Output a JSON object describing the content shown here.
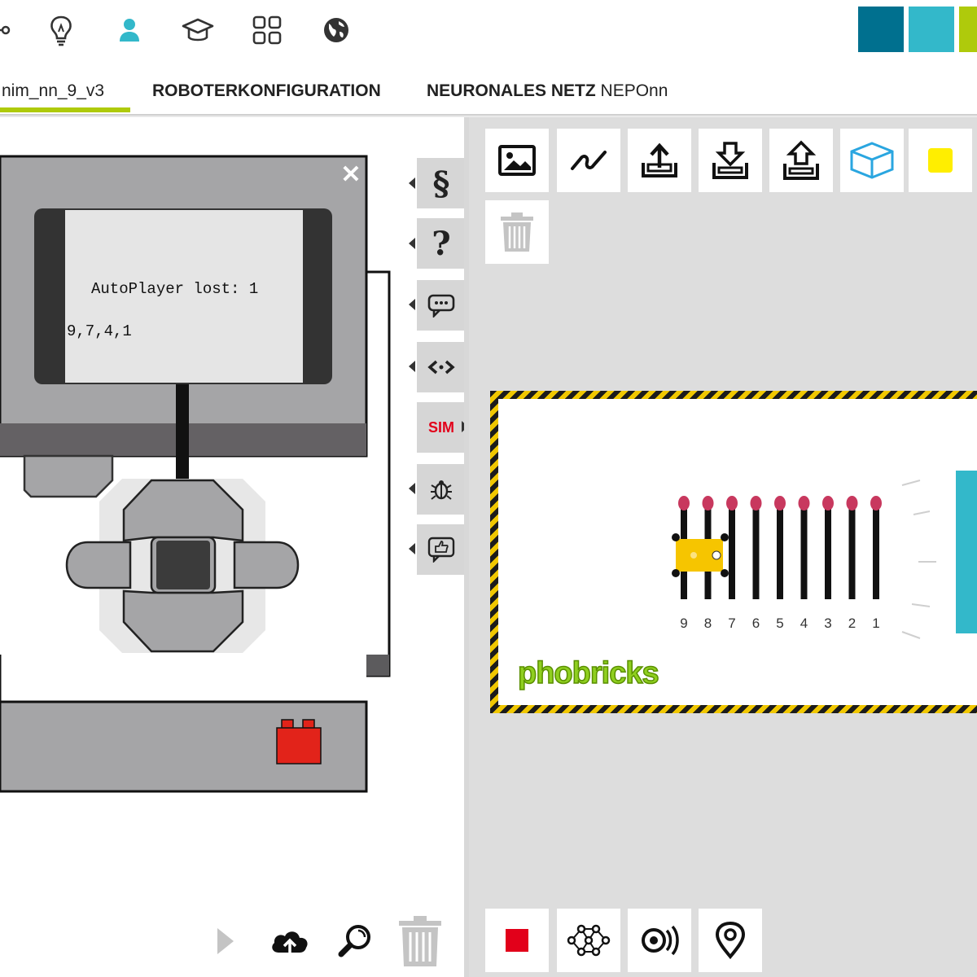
{
  "header": {
    "icons": [
      "network-icon",
      "lightbulb-icon",
      "user-icon",
      "graduation-cap-icon",
      "grid-icon",
      "globe-icon"
    ],
    "accent": "#33b8ca",
    "logo_colors": [
      "#00708f",
      "#33b8ca",
      "#afca0b"
    ]
  },
  "tabs": [
    {
      "label": "nim_nn_9_v3"
    },
    {
      "label": "ROBOTERKONFIGURATION"
    },
    {
      "label": "NEURONALES NETZ",
      "suffix": "NEPOnn"
    }
  ],
  "robot": {
    "lcd_line1": "AutoPlayer lost: 1",
    "lcd_line2": "9,7,4,1"
  },
  "sidebar": {
    "sim_label": "SIM",
    "icons": [
      "section-icon",
      "help-icon",
      "message-icon",
      "code-icon",
      "sim",
      "bug-icon",
      "thumbs-up-icon"
    ]
  },
  "sim_toolbar": {
    "icons": [
      "image-icon",
      "chart-icon",
      "upload-icon",
      "download-icon",
      "import-icon",
      "cube-icon",
      "color-icon",
      "trash-icon"
    ],
    "color_swatch": "#ffee00"
  },
  "stage": {
    "logo_text": "phobricks",
    "match_numbers": [
      "9",
      "8",
      "7",
      "6",
      "5",
      "4",
      "3",
      "2",
      "1"
    ],
    "match_head_color": "#c8385e"
  },
  "sim_bottom": {
    "icons": [
      "stop-icon",
      "network-icon",
      "sensor-icon",
      "location-icon"
    ]
  },
  "left_bottom": {
    "icons": [
      "play-icon",
      "cloud-upload-icon",
      "zoom-icon",
      "trash-icon"
    ]
  }
}
